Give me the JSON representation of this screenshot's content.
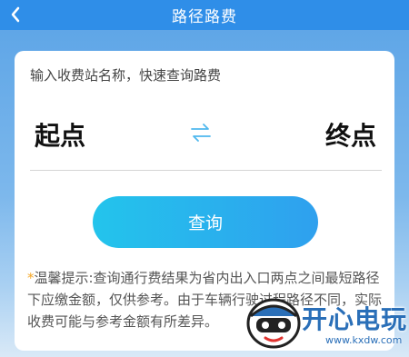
{
  "header": {
    "title": "路径路费",
    "back_icon": "chevron-left-icon"
  },
  "form": {
    "hint": "输入收费站名称，快速查询路费",
    "start_label": "起点",
    "end_label": "终点",
    "swap_icon": "swap-arrows-icon",
    "query_label": "查询"
  },
  "tips": {
    "marker": "*",
    "text": "温馨提示:查询通行费结果为省内出入口两点之间最短路径下应缴金额，仅供参考。由于车辆行驶过程路径不同，实际收费可能与参考金额有所差异。"
  },
  "watermark": {
    "brand": "开心电玩",
    "url": "www.kxdw.com"
  },
  "colors": {
    "header_bg": "#2f8ee8",
    "button_gradient_start": "#23c4ec",
    "button_gradient_end": "#2fa0ee",
    "swap_icon_color": "#4fb8ee",
    "tip_marker": "#f5a623"
  }
}
